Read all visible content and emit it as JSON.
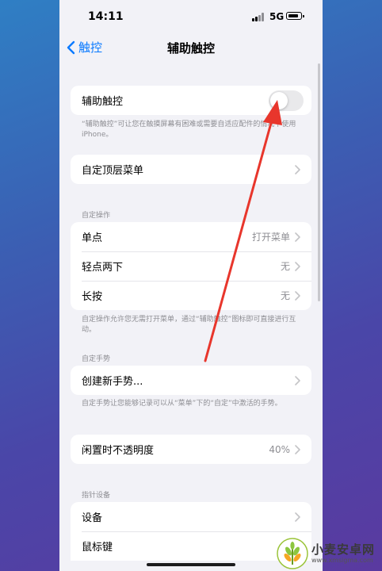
{
  "status_bar": {
    "time": "14:11",
    "network": "5G"
  },
  "nav": {
    "back_label": "触控",
    "title": "辅助触控"
  },
  "toggle_section": {
    "label": "辅助触控",
    "enabled": false,
    "footnote": "“辅助触控”可让您在触摸屏幕有困难或需要自适应配件的情况下使用iPhone。"
  },
  "top_menu": {
    "label": "自定顶层菜单"
  },
  "custom_actions": {
    "header": "自定操作",
    "rows": [
      {
        "label": "单点",
        "value": "打开菜单"
      },
      {
        "label": "轻点两下",
        "value": "无"
      },
      {
        "label": "长按",
        "value": "无"
      }
    ],
    "footnote": "自定操作允许您无需打开菜单，通过“辅助触控”图标即可直接进行互动。"
  },
  "custom_gestures": {
    "header": "自定手势",
    "row_label": "创建新手势...",
    "footnote": "自定手势让您能够记录可以从“菜单”下的“自定”中激活的手势。"
  },
  "idle_opacity": {
    "label": "闲置时不透明度",
    "value": "40%"
  },
  "pointer_devices": {
    "header": "指针设备",
    "rows": [
      {
        "label": "设备"
      },
      {
        "label": "鼠标键"
      }
    ]
  },
  "watermark": {
    "name": "小麦安卓网",
    "url": "www.xmsigma.com"
  },
  "colors": {
    "accent": "#0a7aff",
    "arrow": "#e8362c",
    "background": "#f2f2f7"
  }
}
